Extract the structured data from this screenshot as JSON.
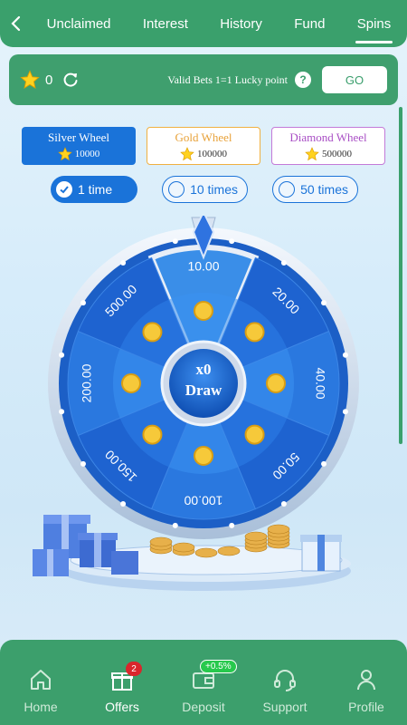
{
  "header": {
    "tabs": [
      {
        "label": "Unclaimed"
      },
      {
        "label": "Interest"
      },
      {
        "label": "History"
      },
      {
        "label": "Fund"
      },
      {
        "label": "Spins",
        "active": true
      }
    ]
  },
  "points": {
    "count": "0",
    "valid_bets_text": "Valid Bets 1=1 Lucky point",
    "help": "?",
    "go_label": "GO"
  },
  "wheel_types": [
    {
      "name": "Silver Wheel",
      "cost": "10000",
      "selected": true
    },
    {
      "name": "Gold Wheel",
      "cost": "100000",
      "selected": false
    },
    {
      "name": "Diamond Wheel",
      "cost": "500000",
      "selected": false
    }
  ],
  "spin_times": [
    {
      "label": "1 time",
      "selected": true
    },
    {
      "label": "10 times",
      "selected": false
    },
    {
      "label": "50 times",
      "selected": false
    }
  ],
  "wheel": {
    "segments": [
      "10.00",
      "20.00",
      "40.00",
      "50.00",
      "100.00",
      "150.00",
      "200.00",
      "500.00"
    ],
    "center_count": "x0",
    "center_label": "Draw"
  },
  "bottom_nav": [
    {
      "label": "Home",
      "icon": "home-icon"
    },
    {
      "label": "Offers",
      "icon": "gift-icon",
      "badge": "2",
      "active": true
    },
    {
      "label": "Deposit",
      "icon": "wallet-icon",
      "badge": "+0.5%"
    },
    {
      "label": "Support",
      "icon": "headset-icon"
    },
    {
      "label": "Profile",
      "icon": "user-icon"
    }
  ],
  "colors": {
    "primary_green": "#3aa06c",
    "primary_blue": "#1a73d9",
    "gold": "#e8a23a",
    "diamond": "#a94fc5"
  }
}
